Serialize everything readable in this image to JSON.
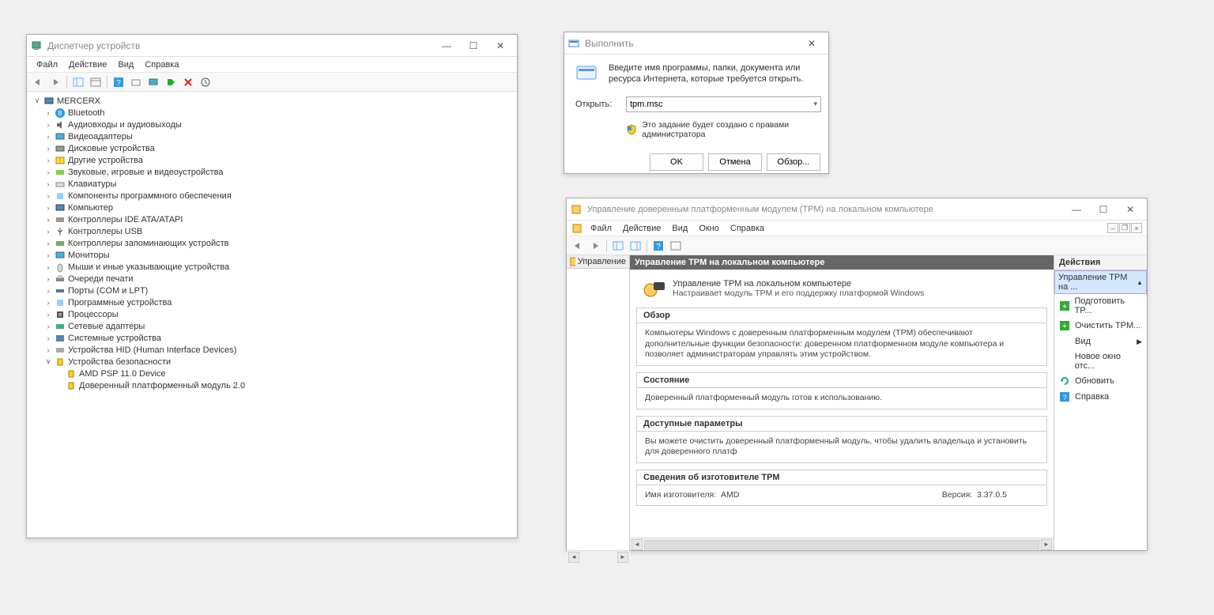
{
  "devmgr": {
    "title": "Диспетчер устройств",
    "menus": [
      "Файл",
      "Действие",
      "Вид",
      "Справка"
    ],
    "root": "MERCERX",
    "nodes": [
      {
        "label": "Bluetooth",
        "icon": "bt"
      },
      {
        "label": "Аудиовходы и аудиовыходы",
        "icon": "audio"
      },
      {
        "label": "Видеоадаптеры",
        "icon": "display"
      },
      {
        "label": "Дисковые устройства",
        "icon": "disk"
      },
      {
        "label": "Другие устройства",
        "icon": "other"
      },
      {
        "label": "Звуковые, игровые и видеоустройства",
        "icon": "sound"
      },
      {
        "label": "Клавиатуры",
        "icon": "kb"
      },
      {
        "label": "Компоненты программного обеспечения",
        "icon": "sw"
      },
      {
        "label": "Компьютер",
        "icon": "pc"
      },
      {
        "label": "Контроллеры IDE ATA/ATAPI",
        "icon": "ide"
      },
      {
        "label": "Контроллеры USB",
        "icon": "usb"
      },
      {
        "label": "Контроллеры запоминающих устройств",
        "icon": "storage"
      },
      {
        "label": "Мониторы",
        "icon": "monitor"
      },
      {
        "label": "Мыши и иные указывающие устройства",
        "icon": "mouse"
      },
      {
        "label": "Очереди печати",
        "icon": "printer"
      },
      {
        "label": "Порты (COM и LPT)",
        "icon": "port"
      },
      {
        "label": "Программные устройства",
        "icon": "sw2"
      },
      {
        "label": "Процессоры",
        "icon": "cpu"
      },
      {
        "label": "Сетевые адаптеры",
        "icon": "net"
      },
      {
        "label": "Системные устройства",
        "icon": "sys"
      },
      {
        "label": "Устройства HID (Human Interface Devices)",
        "icon": "hid"
      }
    ],
    "sec_label": "Устройства безопасности",
    "sec_children": [
      "AMD PSP 11.0 Device",
      "Доверенный платформенный модуль 2.0"
    ]
  },
  "rundlg": {
    "title": "Выполнить",
    "desc": "Введите имя программы, папки, документа или ресурса Интернета, которые требуется открыть.",
    "open_label": "Открыть:",
    "value": "tpm.msc",
    "shield_text": "Это задание будет создано с правами администратора",
    "buttons": {
      "ok": "OK",
      "cancel": "Отмена",
      "browse": "Обзор..."
    }
  },
  "tpmmmc": {
    "title": "Управление доверенным платформенным модулем (TPM) на локальном компьютере",
    "menus": [
      "Файл",
      "Действие",
      "Вид",
      "Окно",
      "Справка"
    ],
    "left_label": "Управление",
    "center_hdr": "Управление TPM на локальном компьютере",
    "intro_title": "Управление TPM на локальном компьютере",
    "intro_desc": "Настраивает модуль TPM и его поддержку платформой Windows",
    "sections": {
      "overview": {
        "hdr": "Обзор",
        "body": "Компьютеры Windows с доверенным платформенным модулем (TPM) обеспечивают дополнительные функции безопасности: доверенном платформенном модуле компьютера и позволяет администраторам управлять этим устройством."
      },
      "status": {
        "hdr": "Состояние",
        "body": "Доверенный платформенный модуль готов к использованию."
      },
      "params": {
        "hdr": "Доступные параметры",
        "body": "Вы можете очистить доверенный платформенный модуль, чтобы удалить владельца и установить для доверенного платф"
      },
      "manuf": {
        "hdr": "Сведения об изготовителе TPM",
        "name_label": "Имя изготовителя:",
        "name_value": "AMD",
        "ver_label": "Версия:",
        "ver_value": "3.37.0.5"
      }
    },
    "right_hdr": "Действия",
    "right_sub": "Управление TPM на ...",
    "actions": [
      {
        "label": "Подготовить TP...",
        "icon": "plus-green"
      },
      {
        "label": "Очистить TPM...",
        "icon": "plus-green"
      },
      {
        "label": "Вид",
        "icon": "none",
        "arrow": true
      },
      {
        "label": "Новое окно отс...",
        "icon": "none"
      },
      {
        "label": "Обновить",
        "icon": "refresh"
      },
      {
        "label": "Справка",
        "icon": "help"
      }
    ]
  }
}
